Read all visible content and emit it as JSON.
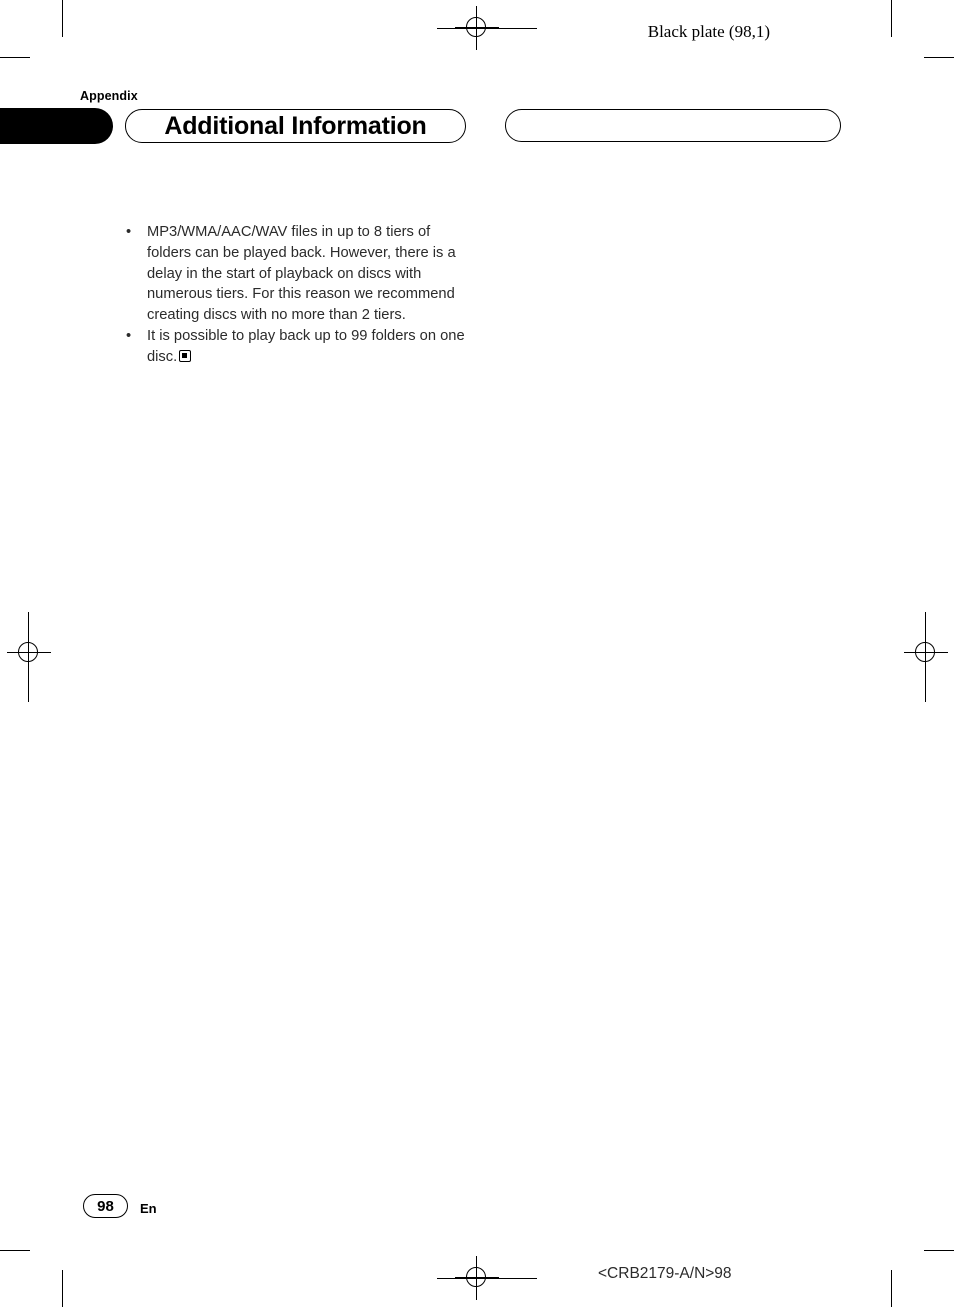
{
  "header": {
    "black_plate": "Black plate (98,1)",
    "section_label": "Appendix",
    "title": "Additional Information"
  },
  "body": {
    "bullets": [
      {
        "marker": "•",
        "text": "MP3/WMA/AAC/WAV files in up to 8 tiers of folders can be played back. However, there is a delay in the start of playback on discs with numerous tiers. For this reason we recommend creating discs with no more than 2 tiers."
      },
      {
        "marker": "•",
        "text": "It is possible to play back up to 99 folders on one disc."
      }
    ]
  },
  "footer": {
    "page_number": "98",
    "language": "En",
    "document_code": "<CRB2179-A/N>98"
  },
  "colors": {
    "ink": "#000000",
    "body_text": "#2b2b2b",
    "paper": "#ffffff"
  }
}
